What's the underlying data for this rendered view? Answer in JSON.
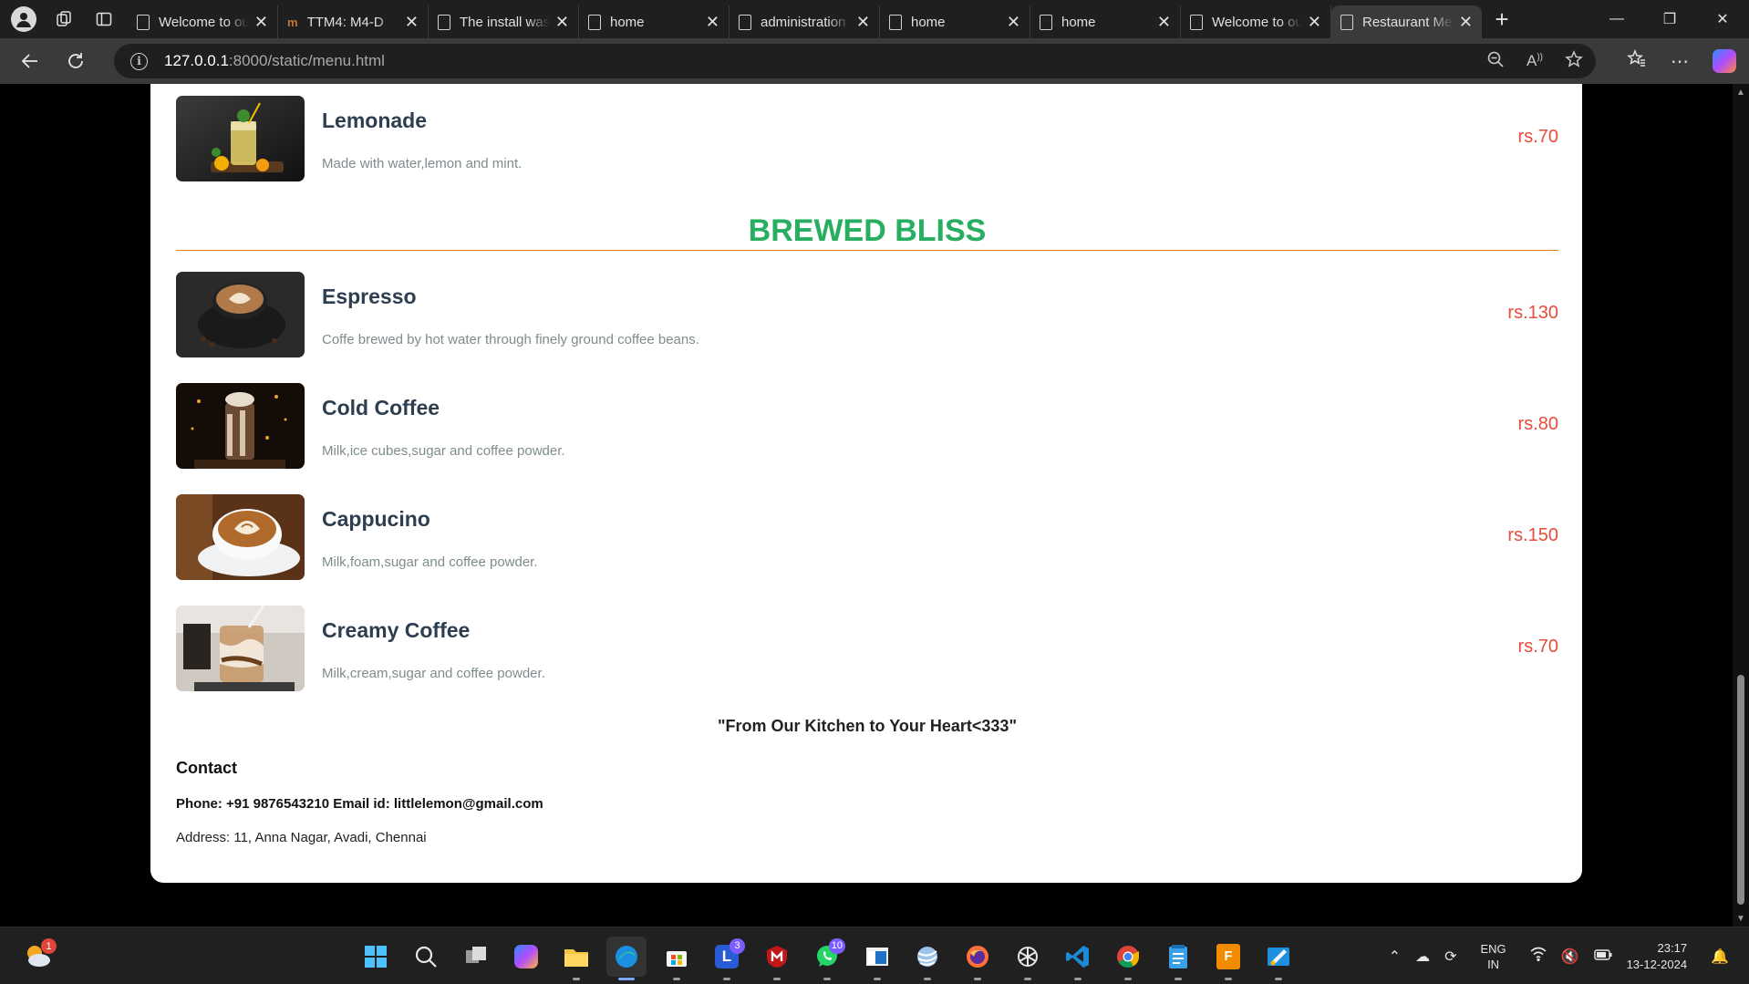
{
  "browser": {
    "tabs": [
      {
        "title": "Welcome to our restaurant",
        "icon": "page-icon",
        "active": false
      },
      {
        "title": "TTM4: M4-D",
        "icon": "m-icon",
        "active": false
      },
      {
        "title": "The install was successful",
        "icon": "page-icon",
        "active": false
      },
      {
        "title": "home",
        "icon": "page-icon",
        "active": false
      },
      {
        "title": "administration",
        "icon": "page-icon",
        "active": false
      },
      {
        "title": "home",
        "icon": "page-icon",
        "active": false
      },
      {
        "title": "home",
        "icon": "page-icon",
        "active": false
      },
      {
        "title": "Welcome to our restaurant",
        "icon": "page-icon",
        "active": false
      },
      {
        "title": "Restaurant Menu",
        "icon": "page-icon",
        "active": true
      }
    ],
    "url_host": "127.0.0.1",
    "url_path": ":8000/static/menu.html"
  },
  "menu": {
    "top_item": {
      "name": "Lemonade",
      "description": "Made with water,lemon and mint.",
      "price": "rs.70"
    },
    "section_title": "BREWED BLISS",
    "items": [
      {
        "name": "Espresso",
        "description": "Coffe brewed by hot water through finely ground coffee beans.",
        "price": "rs.130"
      },
      {
        "name": "Cold Coffee",
        "description": "Milk,ice cubes,sugar and coffee powder.",
        "price": "rs.80"
      },
      {
        "name": "Cappucino",
        "description": "Milk,foam,sugar and coffee powder.",
        "price": "rs.150"
      },
      {
        "name": "Creamy Coffee",
        "description": "Milk,cream,sugar and coffee powder.",
        "price": "rs.70"
      }
    ],
    "tagline": "\"From Our Kitchen to Your Heart<333\"",
    "contact": {
      "heading": "Contact",
      "phone_email": "Phone: +91 9876543210 Email id: littlelemon@gmail.com",
      "address": "Address: 11, Anna Nagar, Avadi, Chennai"
    }
  },
  "colors": {
    "section_title": "#27ae60",
    "rule": "#e67e22",
    "price": "#e74c3c",
    "item_name": "#2c3e50",
    "description": "#7f8c8d"
  },
  "taskbar": {
    "weather_badge": "1",
    "apps": [
      {
        "name": "start-icon"
      },
      {
        "name": "search-icon"
      },
      {
        "name": "task-view-icon"
      },
      {
        "name": "copilot-icon"
      },
      {
        "name": "file-explorer-icon"
      },
      {
        "name": "edge-icon",
        "active": true
      },
      {
        "name": "store-icon"
      },
      {
        "name": "teams-icon",
        "badge": "3"
      },
      {
        "name": "mcafee-icon"
      },
      {
        "name": "whatsapp-icon",
        "badge": "10"
      },
      {
        "name": "window-app-icon"
      },
      {
        "name": "globe-app-icon"
      },
      {
        "name": "firefox-icon"
      },
      {
        "name": "chatgpt-icon"
      },
      {
        "name": "vscode-icon"
      },
      {
        "name": "chrome-icon"
      },
      {
        "name": "notepad-icon"
      },
      {
        "name": "fl-studio-icon"
      },
      {
        "name": "paint-icon"
      }
    ],
    "lang_top": "ENG",
    "lang_bottom": "IN",
    "time": "23:17",
    "date": "13-12-2024"
  }
}
